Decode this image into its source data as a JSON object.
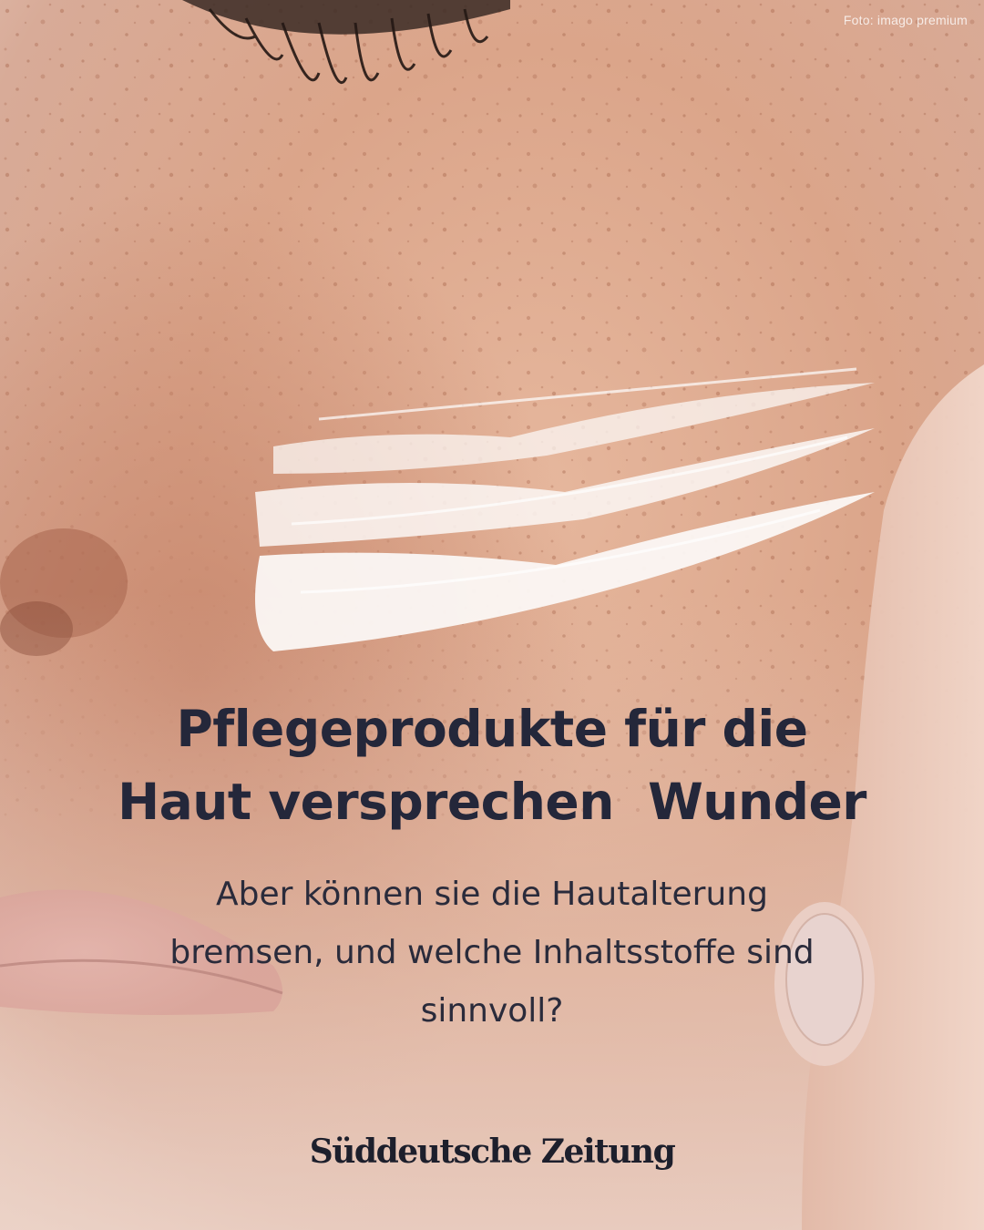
{
  "credit": "Foto: imago premium",
  "headline": {
    "line1": "Pflegeprodukte für die",
    "line2": "Haut versprechen  Wunder"
  },
  "subline": {
    "line1": "Aber können sie die Hautalterung",
    "line2": "bremsen, und welche Inhaltsstoffe sind",
    "line3": "sinnvoll?"
  },
  "brand": "Süddeutsche Zeitung",
  "colors": {
    "text_dark": "#24273a",
    "skin_base": "#d9a58c"
  }
}
